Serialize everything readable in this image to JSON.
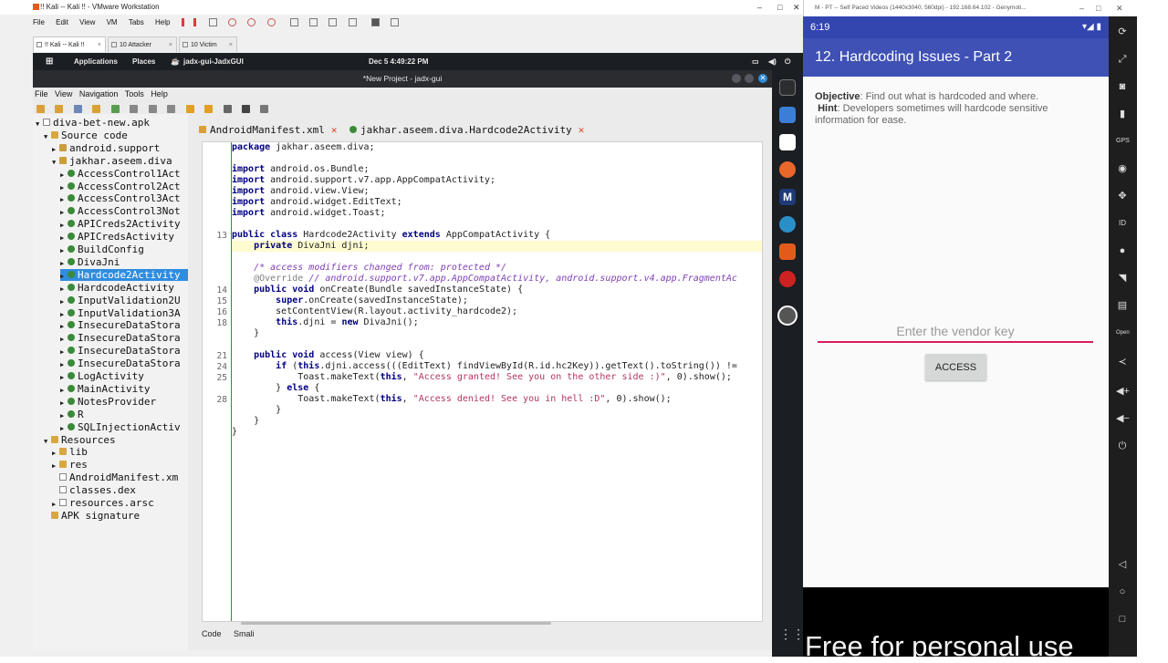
{
  "vmware": {
    "title": "!! Kali -- Kali !! - VMware Workstation",
    "menu": [
      "File",
      "Edit",
      "View",
      "VM",
      "Tabs",
      "Help"
    ],
    "tabs": [
      "!! Kali -- Kali !!",
      "10 Attacker",
      "10 Victim"
    ]
  },
  "kali_panel": {
    "applications": "Applications",
    "places": "Places",
    "active_app": "jadx-gui-JadxGUI",
    "clock": "Dec 5  4:49:22 PM"
  },
  "jadx": {
    "window_title": "*New Project - jadx-gui",
    "menu": [
      "File",
      "View",
      "Navigation",
      "Tools",
      "Help"
    ],
    "tree": [
      {
        "label": "diva-bet-new.apk",
        "icon": "file",
        "arrow": "▼"
      },
      {
        "label": "Source code",
        "icon": "folder",
        "arrow": "▼"
      },
      {
        "label": "android.support",
        "icon": "package",
        "arrow": "▶"
      },
      {
        "label": "jakhar.aseem.diva",
        "icon": "package",
        "arrow": "▼"
      },
      {
        "label": "AccessControl1Act",
        "icon": "class",
        "arrow": "▶"
      },
      {
        "label": "AccessControl2Act",
        "icon": "class",
        "arrow": "▶"
      },
      {
        "label": "AccessControl3Act",
        "icon": "class",
        "arrow": "▶"
      },
      {
        "label": "AccessControl3Not",
        "icon": "class",
        "arrow": "▶"
      },
      {
        "label": "APICreds2Activity",
        "icon": "class",
        "arrow": "▶"
      },
      {
        "label": "APICredsActivity",
        "icon": "class",
        "arrow": "▶"
      },
      {
        "label": "BuildConfig",
        "icon": "class",
        "arrow": "▶"
      },
      {
        "label": "DivaJni",
        "icon": "class",
        "arrow": "▶"
      },
      {
        "label": "Hardcode2Activity",
        "icon": "class",
        "arrow": "▶"
      },
      {
        "label": "HardcodeActivity",
        "icon": "class",
        "arrow": "▶"
      },
      {
        "label": "InputValidation2U",
        "icon": "class",
        "arrow": "▶"
      },
      {
        "label": "InputValidation3A",
        "icon": "class",
        "arrow": "▶"
      },
      {
        "label": "InsecureDataStora",
        "icon": "class",
        "arrow": "▶"
      },
      {
        "label": "InsecureDataStora",
        "icon": "class",
        "arrow": "▶"
      },
      {
        "label": "InsecureDataStora",
        "icon": "class",
        "arrow": "▶"
      },
      {
        "label": "InsecureDataStora",
        "icon": "class",
        "arrow": "▶"
      },
      {
        "label": "LogActivity",
        "icon": "class",
        "arrow": "▶"
      },
      {
        "label": "MainActivity",
        "icon": "class",
        "arrow": "▶"
      },
      {
        "label": "NotesProvider",
        "icon": "class",
        "arrow": "▶"
      },
      {
        "label": "R",
        "icon": "class",
        "arrow": "▶"
      },
      {
        "label": "SQLInjectionActiv",
        "icon": "class",
        "arrow": "▶"
      },
      {
        "label": "Resources",
        "icon": "folder",
        "arrow": "▼"
      },
      {
        "label": "lib",
        "icon": "folder",
        "arrow": "▶"
      },
      {
        "label": "res",
        "icon": "folder",
        "arrow": "▶"
      },
      {
        "label": "AndroidManifest.xm",
        "icon": "file",
        "arrow": ""
      },
      {
        "label": "classes.dex",
        "icon": "file",
        "arrow": ""
      },
      {
        "label": "resources.arsc",
        "icon": "file",
        "arrow": "▶"
      },
      {
        "label": "APK signature",
        "icon": "key",
        "arrow": ""
      }
    ],
    "selected_tree_item": "Hardcode2Activity",
    "editor_tabs": [
      "AndroidManifest.xml",
      "jakhar.aseem.diva.Hardcode2Activity"
    ],
    "code_lines": [
      {
        "n": "",
        "html": "<span class=\"kw\">package</span> jakhar.aseem.diva;"
      },
      {
        "n": "",
        "html": ""
      },
      {
        "n": "",
        "html": "<span class=\"kw\">import</span> android.os.Bundle;"
      },
      {
        "n": "",
        "html": "<span class=\"kw\">import</span> android.support.v7.app.AppCompatActivity;"
      },
      {
        "n": "",
        "html": "<span class=\"kw\">import</span> android.view.View;"
      },
      {
        "n": "",
        "html": "<span class=\"kw\">import</span> android.widget.EditText;"
      },
      {
        "n": "",
        "html": "<span class=\"kw\">import</span> android.widget.Toast;"
      },
      {
        "n": "",
        "html": ""
      },
      {
        "n": "13",
        "html": "<span class=\"kw\">public class</span> Hardcode2Activity <span class=\"kw\">extends</span> AppCompatActivity {"
      },
      {
        "n": "",
        "html": "    <span class=\"kw\">private</span> DivaJni djni;",
        "hl": true
      },
      {
        "n": "",
        "html": ""
      },
      {
        "n": "",
        "html": "    <span class=\"cm\">/* access modifiers changed from: protected */</span>"
      },
      {
        "n": "",
        "html": "    <span class=\"an\">@Override</span> <span class=\"cm\">// android.support.v7.app.AppCompatActivity, android.support.v4.app.FragmentAc</span>"
      },
      {
        "n": "14",
        "html": "    <span class=\"kw\">public void</span> onCreate(Bundle savedInstanceState) {"
      },
      {
        "n": "15",
        "html": "        <span class=\"kw\">super</span>.onCreate(savedInstanceState);"
      },
      {
        "n": "16",
        "html": "        setContentView(R.layout.activity_hardcode2);"
      },
      {
        "n": "18",
        "html": "        <span class=\"kw\">this</span>.djni = <span class=\"kw\">new</span> DivaJni();"
      },
      {
        "n": "",
        "html": "    }"
      },
      {
        "n": "",
        "html": ""
      },
      {
        "n": "21",
        "html": "    <span class=\"kw\">public void</span> access(View view) {"
      },
      {
        "n": "24",
        "html": "        <span class=\"kw\">if</span> (<span class=\"kw\">this</span>.djni.access(((EditText) findViewById(R.id.hc2Key)).getText().toString()) !="
      },
      {
        "n": "25",
        "html": "            Toast.makeText(<span class=\"kw\">this</span>, <span class=\"str\">\"Access granted! See you on the other side :)\"</span>, 0).show();"
      },
      {
        "n": "",
        "html": "        } <span class=\"kw\">else</span> {"
      },
      {
        "n": "28",
        "html": "            Toast.makeText(<span class=\"kw\">this</span>, <span class=\"str\">\"Access denied! See you in hell :D\"</span>, 0).show();"
      },
      {
        "n": "",
        "html": "        }"
      },
      {
        "n": "",
        "html": "    }"
      },
      {
        "n": "",
        "html": "}"
      }
    ],
    "bottom_tabs": [
      "Code",
      "Smali"
    ]
  },
  "genymotion": {
    "title": "M - PT -- Self Paced Videos (1440x3040, 560dpi) - 192.168.64.102 - Genymoti..."
  },
  "phone": {
    "time": "6:19",
    "app_title": "12. Hardcoding Issues - Part 2",
    "objective_label": "Objective",
    "objective_text": ": Find out what is hardcoded and where.",
    "hint_label": "Hint",
    "hint_text": ": Developers sometimes will hardcode sensitive information for ease.",
    "input_placeholder": "Enter the vendor key",
    "button_label": "ACCESS",
    "watermark": "Free for personal use"
  },
  "colors": {
    "app_bar": "#3f51b5",
    "status_bar": "#3346b0",
    "input_underline": "#d81b60",
    "tree_selection": "#2f8de0"
  }
}
